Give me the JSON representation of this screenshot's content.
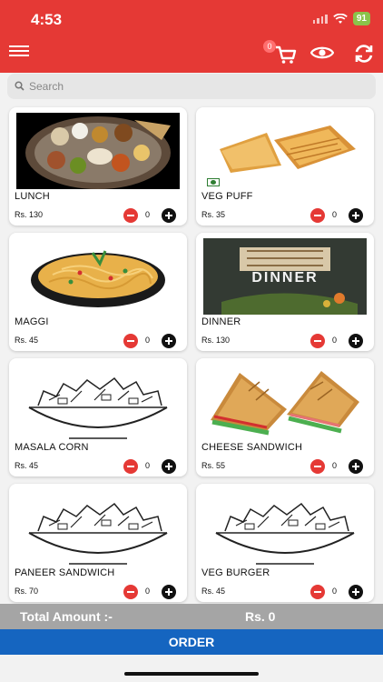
{
  "status_bar": {
    "time": "4:53",
    "battery": "91"
  },
  "header": {
    "cart_count": "0",
    "icons": [
      "menu-icon",
      "cart-icon",
      "eye-icon",
      "sync-icon"
    ]
  },
  "search": {
    "placeholder": "Search",
    "value": ""
  },
  "items": [
    {
      "name": "LUNCH",
      "price": "Rs. 130",
      "qty": "0"
    },
    {
      "name": "VEG PUFF",
      "price": "Rs. 35",
      "qty": "0"
    },
    {
      "name": "MAGGI",
      "price": "Rs. 45",
      "qty": "0"
    },
    {
      "name": "DINNER",
      "price": "Rs. 130",
      "qty": "0",
      "image_text": "DINNER"
    },
    {
      "name": "MASALA CORN",
      "price": "Rs. 45",
      "qty": "0"
    },
    {
      "name": "CHEESE SANDWICH",
      "price": "Rs. 55",
      "qty": "0"
    },
    {
      "name": "PANEER SANDWICH",
      "price": "Rs. 70",
      "qty": "0"
    },
    {
      "name": "VEG BURGER",
      "price": "Rs. 45",
      "qty": "0"
    }
  ],
  "footer": {
    "total_label": "Total Amount :-",
    "total_value": "Rs. 0",
    "order_label": "ORDER"
  },
  "colors": {
    "header": "#e53935",
    "order_button": "#1565c0",
    "total_bar": "#a5a5a5",
    "minus": "#e53935",
    "plus": "#111111"
  }
}
